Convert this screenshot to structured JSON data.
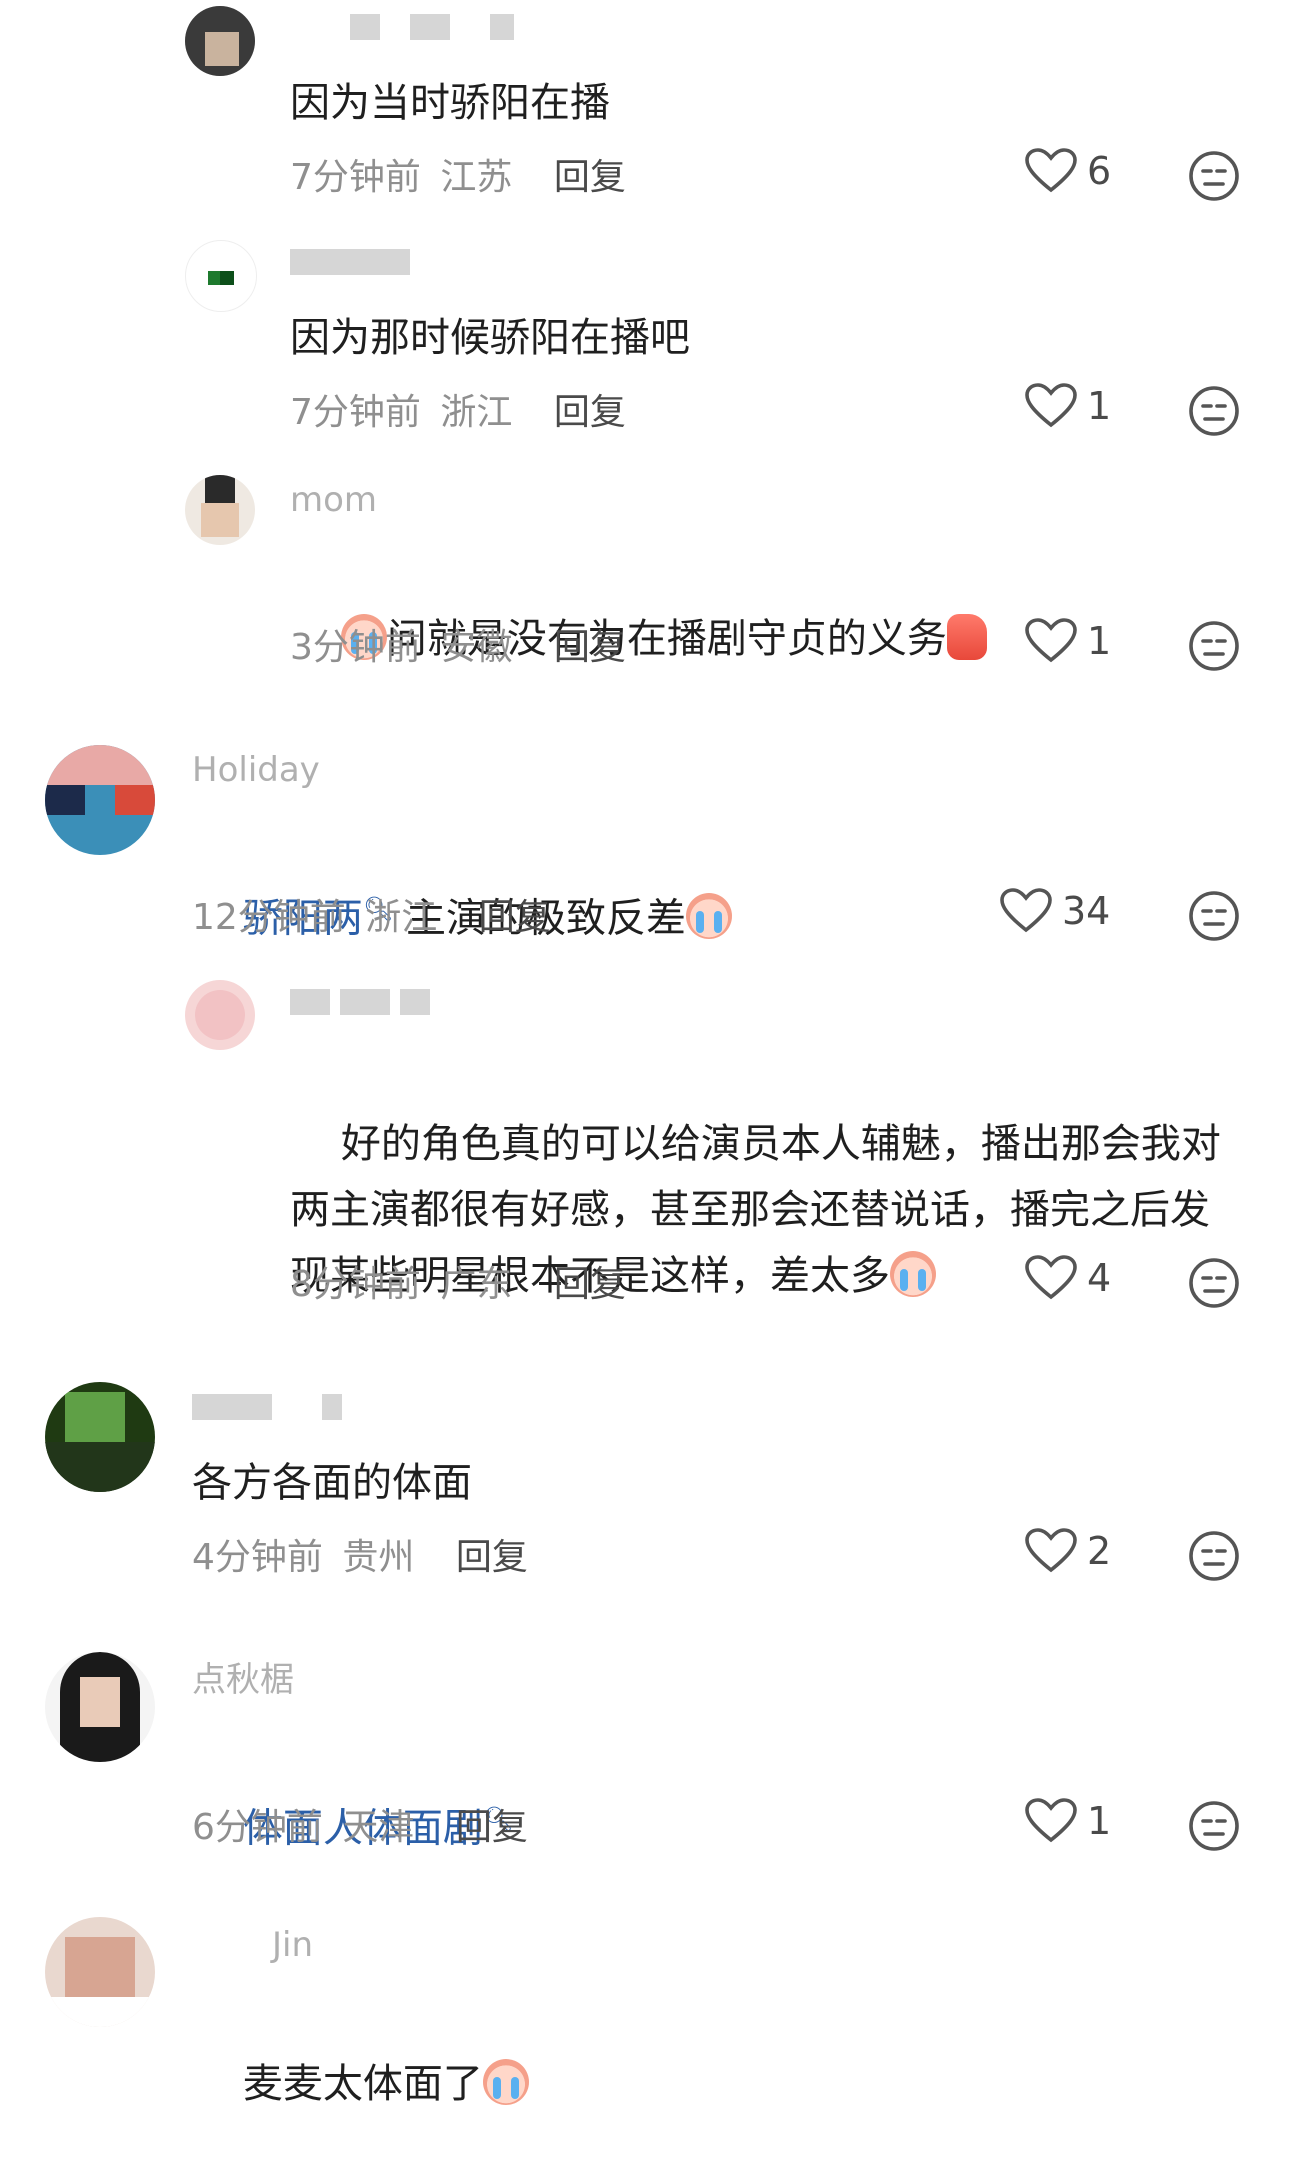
{
  "comments": [
    {
      "username": "",
      "text": "因为当时骄阳在播",
      "time": "7分钟前",
      "location": "江苏",
      "reply_label": "回复",
      "likes": "6"
    },
    {
      "username": "",
      "text": "因为那时候骄阳在播吧",
      "time": "7分钟前",
      "location": "浙江",
      "reply_label": "回复",
      "likes": "1"
    },
    {
      "username": "mom",
      "text": "问就是没有为在播剧守贞的义务",
      "time": "3分钟前",
      "location": "安徽",
      "reply_label": "回复",
      "likes": "1"
    },
    {
      "username": "Holiday",
      "text_link": "骄阳两",
      "text": " 主演的极致反差",
      "time": "12分钟前",
      "location": "浙江",
      "reply_label": "回复",
      "likes": "34"
    },
    {
      "username": "",
      "text": "好的角色真的可以给演员本人辅魅，播出那会我对两主演都很有好感，甚至那会还替说话，播完之后发现某些明星根本不是这样，差太多",
      "time": "8分钟前",
      "location": "广东",
      "reply_label": "回复",
      "likes": "4"
    },
    {
      "username": "",
      "text": "各方各面的体面",
      "time": "4分钟前",
      "location": "贵州",
      "reply_label": "回复",
      "likes": "2"
    },
    {
      "username": "点秋椐",
      "text_link": "体面人体面剧",
      "time": "6分钟前",
      "location": "天津",
      "reply_label": "回复",
      "likes": "1"
    },
    {
      "username": "Jin",
      "text": "麦麦太体面了",
      "time": "",
      "location": "",
      "reply_label": "",
      "likes": ""
    }
  ],
  "colors": {
    "link": "#2b5fa8",
    "meta": "#8f8f8f",
    "text": "#1f1f1f"
  }
}
